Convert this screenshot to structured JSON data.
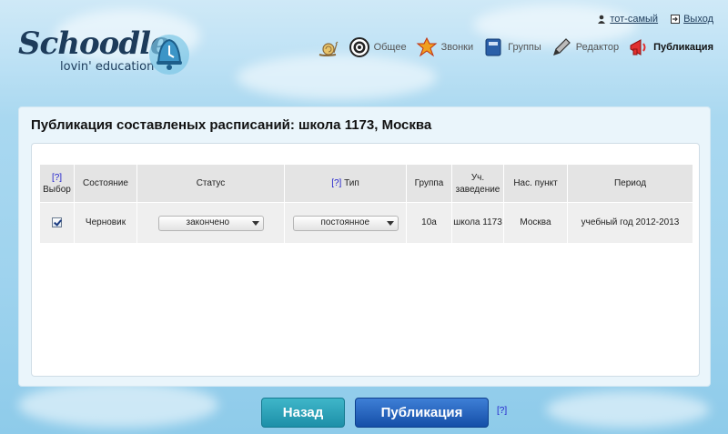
{
  "brand": {
    "name": "Schoodle",
    "tagline": "lovin' education"
  },
  "userbar": {
    "user": "тот-самый",
    "logout": "Выход"
  },
  "nav": [
    {
      "label": "",
      "icon": "snail-icon"
    },
    {
      "label": "Общее",
      "icon": "target-icon"
    },
    {
      "label": "Звонки",
      "icon": "leaf-icon"
    },
    {
      "label": "Группы",
      "icon": "book-icon"
    },
    {
      "label": "Редактор",
      "icon": "pencil-icon"
    },
    {
      "label": "Публикация",
      "icon": "megaphone-icon",
      "active": true
    }
  ],
  "page": {
    "title": "Публикация составленых расписаний: школа 1173, Москва"
  },
  "table": {
    "help": "[?]",
    "headers": {
      "select": "Выбор",
      "state": "Состояние",
      "status": "Статус",
      "type": "Тип",
      "group": "Группа",
      "school": "Уч. заведение",
      "city": "Нас. пункт",
      "period": "Период"
    },
    "rows": [
      {
        "checked": true,
        "state": "Черновик",
        "status": "закончено",
        "type": "постоянное",
        "group": "10а",
        "school": "школа 1173",
        "city": "Москва",
        "period": "учебный год 2012-2013"
      }
    ]
  },
  "buttons": {
    "back": "Назад",
    "publish": "Публикация",
    "help": "[?]"
  },
  "colors": {
    "back": "#1d8fa8",
    "publish": "#154fa8",
    "link": "#2222cc"
  }
}
